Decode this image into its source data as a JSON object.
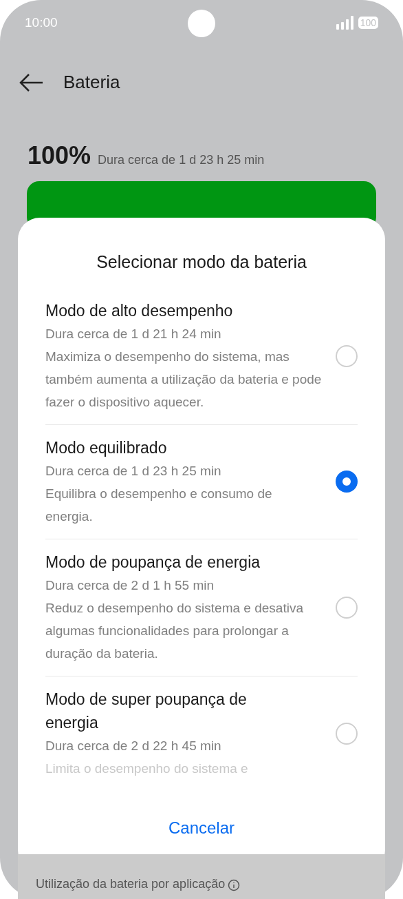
{
  "status_bar": {
    "time": "10:00",
    "battery": "100"
  },
  "header": {
    "title": "Bateria"
  },
  "battery": {
    "percent": "100%",
    "estimate": "Dura cerca de 1 d 23 h 25 min",
    "level": 1
  },
  "sheet": {
    "title": "Selecionar modo da bateria",
    "options": [
      {
        "title": "Modo de alto desempenho",
        "duration": "Dura cerca de 1 d 21 h 24 min",
        "description": "Maximiza o desempenho do sistema, mas também aumenta a utilização da bateria e pode fazer o dispositivo aquecer.",
        "selected": false
      },
      {
        "title": "Modo equilibrado",
        "duration": "Dura cerca de 1 d 23 h 25 min",
        "description": "Equilibra o desempenho e consumo de energia.",
        "selected": true
      },
      {
        "title": "Modo de poupança de energia",
        "duration": "Dura cerca de 2 d 1 h 55 min",
        "description": "Reduz o desempenho do sistema e desativa algumas funcionalidades para prolongar a duração da bateria.",
        "selected": false
      },
      {
        "title": "Modo de super poupança de energia",
        "duration": "Dura cerca de 2 d 22 h 45 min",
        "description": "Limita o desempenho do sistema e",
        "selected": false
      }
    ],
    "cancel": "Cancelar"
  },
  "background_section": {
    "label": "Utilização da bateria por aplicação"
  }
}
